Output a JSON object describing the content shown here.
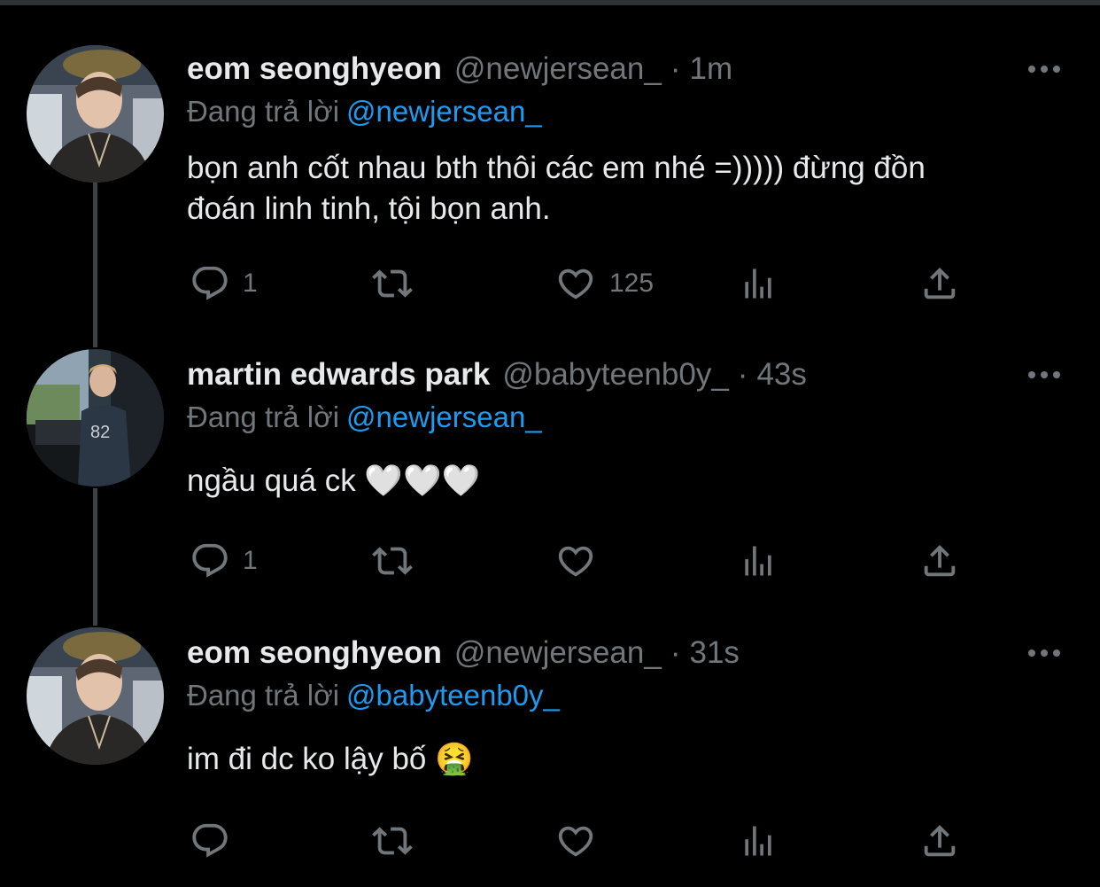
{
  "tweets": [
    {
      "name": "eom seonghyeon",
      "handle": "@newjersean_",
      "separator": "·",
      "time": "1m",
      "reply_prefix": "Đang trả lời",
      "reply_to": "@newjersean_",
      "text_line1": "bọn anh cốt nhau bth thôi các em nhé =))))) đừng đồn",
      "text_line2": "đoán linh tinh, tội bọn anh.",
      "reply_count": "1",
      "retweet_count": "",
      "like_count": "125"
    },
    {
      "name": "martin edwards park",
      "handle": "@babyteenb0y_",
      "separator": "·",
      "time": "43s",
      "reply_prefix": "Đang trả lời",
      "reply_to": "@newjersean_",
      "text_line1": "ngầu quá ck 🤍🤍🤍",
      "text_line2": "",
      "reply_count": "1",
      "retweet_count": "",
      "like_count": ""
    },
    {
      "name": "eom seonghyeon",
      "handle": "@newjersean_",
      "separator": "·",
      "time": "31s",
      "reply_prefix": "Đang trả lời",
      "reply_to": "@babyteenb0y_",
      "text_line1": "im đi dc ko lậy bố 🤮",
      "text_line2": "",
      "reply_count": "",
      "retweet_count": "",
      "like_count": ""
    }
  ],
  "icons": [
    "reply-icon",
    "retweet-icon",
    "like-icon",
    "analytics-icon",
    "share-icon",
    "more-icon"
  ],
  "colors": {
    "background": "#000000",
    "text": "#e7e9ea",
    "secondary": "#71767b",
    "accent": "#1d9bf0",
    "thread_line": "#3e4144"
  }
}
